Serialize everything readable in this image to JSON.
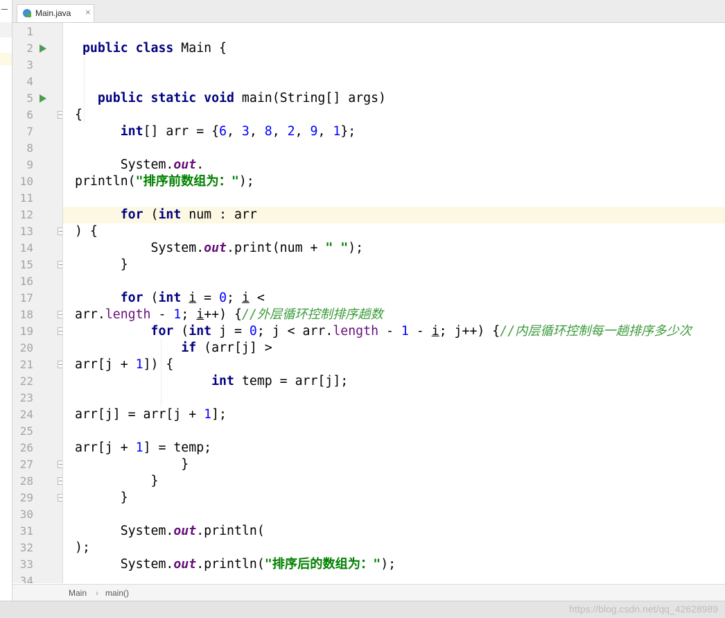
{
  "tab": {
    "file_name": "Main.java",
    "close_glyph": "×",
    "icon": "java-class-icon"
  },
  "gutter": {
    "line_numbers": [
      "1",
      "2",
      "3",
      "4",
      "5",
      "6",
      "7",
      "8",
      "9",
      "10",
      "11",
      "12",
      "13",
      "14",
      "15",
      "16",
      "17",
      "18",
      "19",
      "20",
      "21",
      "22",
      "23",
      "24",
      "25",
      "26",
      "27",
      "28",
      "29",
      "30",
      "31",
      "32",
      "33",
      "34"
    ]
  },
  "editor": {
    "current_line": 12,
    "lines": [
      [],
      [
        {
          "t": " "
        },
        {
          "t": "public",
          "c": "kw"
        },
        {
          "t": " "
        },
        {
          "t": "class",
          "c": "kw"
        },
        {
          "t": " Main {"
        }
      ],
      [],
      [],
      [
        {
          "t": "   "
        },
        {
          "t": "public",
          "c": "kw"
        },
        {
          "t": " "
        },
        {
          "t": "static",
          "c": "kw"
        },
        {
          "t": " "
        },
        {
          "t": "void",
          "c": "kw"
        },
        {
          "t": " main(String[] args)"
        }
      ],
      [
        {
          "t": "{"
        }
      ],
      [
        {
          "t": "      "
        },
        {
          "t": "int",
          "c": "kw"
        },
        {
          "t": "[] arr = {"
        },
        {
          "t": "6",
          "c": "num"
        },
        {
          "t": ", "
        },
        {
          "t": "3",
          "c": "num"
        },
        {
          "t": ", "
        },
        {
          "t": "8",
          "c": "num"
        },
        {
          "t": ", "
        },
        {
          "t": "2",
          "c": "num"
        },
        {
          "t": ", "
        },
        {
          "t": "9",
          "c": "num"
        },
        {
          "t": ", "
        },
        {
          "t": "1",
          "c": "num"
        },
        {
          "t": "};"
        }
      ],
      [],
      [
        {
          "t": "      System."
        },
        {
          "t": "out",
          "c": "fld"
        },
        {
          "t": "."
        }
      ],
      [
        {
          "t": "println("
        },
        {
          "t": "\"排序前数组为：\"",
          "c": "str"
        },
        {
          "t": ");"
        }
      ],
      [],
      [
        {
          "t": "      "
        },
        {
          "t": "for",
          "c": "kw"
        },
        {
          "t": " ("
        },
        {
          "t": "int",
          "c": "kw"
        },
        {
          "t": " num : arr"
        }
      ],
      [
        {
          "t": ") {"
        }
      ],
      [
        {
          "t": "          System."
        },
        {
          "t": "out",
          "c": "fld"
        },
        {
          "t": ".print(num + "
        },
        {
          "t": "\" \"",
          "c": "str"
        },
        {
          "t": ");"
        }
      ],
      [
        {
          "t": "      }"
        }
      ],
      [],
      [
        {
          "t": "      "
        },
        {
          "t": "for",
          "c": "kw"
        },
        {
          "t": " ("
        },
        {
          "t": "int",
          "c": "kw"
        },
        {
          "t": " "
        },
        {
          "t": "i",
          "c": "under"
        },
        {
          "t": " = "
        },
        {
          "t": "0",
          "c": "num"
        },
        {
          "t": "; "
        },
        {
          "t": "i",
          "c": "under"
        },
        {
          "t": " <"
        }
      ],
      [
        {
          "t": "arr."
        },
        {
          "t": "length",
          "c": "prop"
        },
        {
          "t": " - "
        },
        {
          "t": "1",
          "c": "num"
        },
        {
          "t": "; "
        },
        {
          "t": "i",
          "c": "under"
        },
        {
          "t": "++) {"
        },
        {
          "t": "//外层循环控制排序趟数",
          "c": "cmtg"
        }
      ],
      [
        {
          "t": "          "
        },
        {
          "t": "for",
          "c": "kw"
        },
        {
          "t": " ("
        },
        {
          "t": "int",
          "c": "kw"
        },
        {
          "t": " j = "
        },
        {
          "t": "0",
          "c": "num"
        },
        {
          "t": "; j < arr."
        },
        {
          "t": "length",
          "c": "prop"
        },
        {
          "t": " - "
        },
        {
          "t": "1",
          "c": "num"
        },
        {
          "t": " - "
        },
        {
          "t": "i",
          "c": "under"
        },
        {
          "t": "; j++) {"
        },
        {
          "t": "//内层循环控制每一趟排序多少次",
          "c": "cmtg"
        }
      ],
      [
        {
          "t": "              "
        },
        {
          "t": "if",
          "c": "kw"
        },
        {
          "t": " (arr[j] >"
        }
      ],
      [
        {
          "t": "arr[j + "
        },
        {
          "t": "1",
          "c": "num"
        },
        {
          "t": "]) {"
        }
      ],
      [
        {
          "t": "                  "
        },
        {
          "t": "int",
          "c": "kw"
        },
        {
          "t": " temp = arr[j];"
        }
      ],
      [],
      [
        {
          "t": "arr[j] = arr[j + "
        },
        {
          "t": "1",
          "c": "num"
        },
        {
          "t": "];"
        }
      ],
      [],
      [
        {
          "t": "arr[j + "
        },
        {
          "t": "1",
          "c": "num"
        },
        {
          "t": "] = temp;"
        }
      ],
      [
        {
          "t": "              }"
        }
      ],
      [
        {
          "t": "          }"
        }
      ],
      [
        {
          "t": "      }"
        }
      ],
      [],
      [
        {
          "t": "      System."
        },
        {
          "t": "out",
          "c": "fld"
        },
        {
          "t": ".println("
        }
      ],
      [
        {
          "t": ");"
        }
      ],
      [
        {
          "t": "      System."
        },
        {
          "t": "out",
          "c": "fld"
        },
        {
          "t": ".println("
        },
        {
          "t": "\"排序后的数组为：\"",
          "c": "str"
        },
        {
          "t": ");"
        }
      ],
      []
    ]
  },
  "run_markers": [
    2,
    5
  ],
  "fold_markers": [
    {
      "line": 6,
      "kind": "open"
    },
    {
      "line": 13,
      "kind": "open"
    },
    {
      "line": 15,
      "kind": "close"
    },
    {
      "line": 18,
      "kind": "open"
    },
    {
      "line": 19,
      "kind": "open"
    },
    {
      "line": 21,
      "kind": "open"
    },
    {
      "line": 27,
      "kind": "close"
    },
    {
      "line": 28,
      "kind": "close"
    },
    {
      "line": 29,
      "kind": "close"
    }
  ],
  "breadcrumb": {
    "class_name": "Main",
    "separator": "›",
    "method_name": "main()"
  },
  "watermark": "https://blog.csdn.net/qq_42628989"
}
